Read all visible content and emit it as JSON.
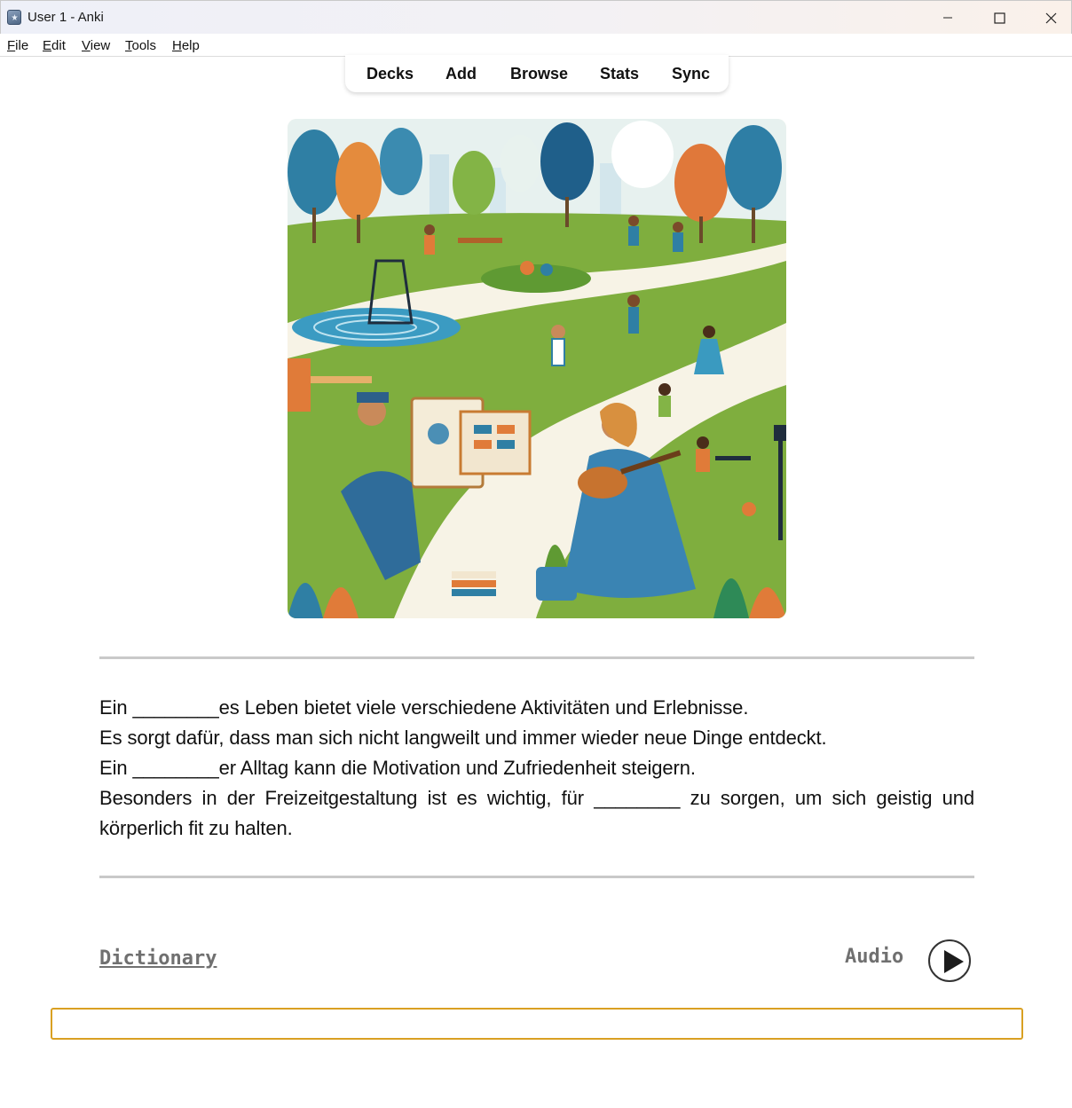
{
  "window": {
    "title": "User 1 - Anki",
    "controls": {
      "minimize": "minimize-icon",
      "maximize": "maximize-icon",
      "close": "close-icon"
    }
  },
  "menu": [
    {
      "mnemonic": "F",
      "rest": "ile"
    },
    {
      "mnemonic": "E",
      "rest": "dit"
    },
    {
      "mnemonic": "V",
      "rest": "iew"
    },
    {
      "mnemonic": "T",
      "rest": "ools"
    },
    {
      "mnemonic": "H",
      "rest": "elp"
    }
  ],
  "toolbar": {
    "decks": "Decks",
    "add": "Add",
    "browse": "Browse",
    "stats": "Stats",
    "sync": "Sync"
  },
  "card": {
    "image_description_icon": "park-leisure-activities-illustration",
    "lines": [
      "Ein ________es Leben bietet viele verschiedene Aktivitäten und Erlebnisse.",
      "Es sorgt dafür, dass man sich nicht langweilt und immer wieder neue Dinge entdeckt.",
      "Ein ________er Alltag kann die Motivation und Zufriedenheit steigern.",
      "Besonders in der Freizeitgestaltung ist es wichtig, für ________ zu sorgen, um sich geistig und körperlich fit zu halten."
    ],
    "dictionary_label": "Dictionary",
    "audio_label": "Audio",
    "play_icon": "play-icon",
    "answer_value": ""
  },
  "colors": {
    "answer_border": "#d9a022",
    "divider": "#c9c9c9",
    "muted_link": "#707070"
  }
}
